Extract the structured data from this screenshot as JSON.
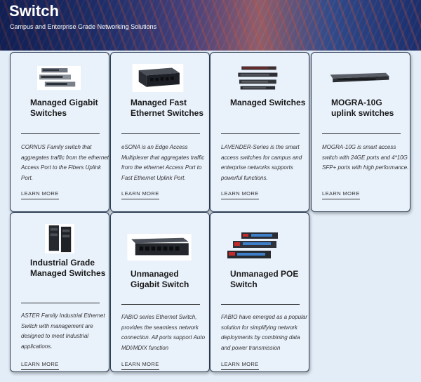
{
  "hero": {
    "title": "Switch",
    "subtitle": "Campus and Enterprise Grade Networking Solutions"
  },
  "cards": [
    {
      "title": "Managed Gigabit Switches",
      "description": "CORNUS Family switch that aggregates traffic from the ethernet Access Port to the Fibers Uplink Port.",
      "link": "LEARN MORE",
      "image_icon": "stacked-gigabit-switches-icon"
    },
    {
      "title": "Managed Fast Ethernet Switches",
      "description": "eSONA is an Edge Access Multiplexer that aggregates traffic from the ethernet Access Port to Fast Ethernet Uplink Port.",
      "link": "LEARN MORE",
      "image_icon": "desktop-switch-icon"
    },
    {
      "title": "Managed Switches",
      "description": "LAVENDER-Series is the smart access switches for campus and enterprise networks supports powerful functions.",
      "link": "LEARN MORE",
      "image_icon": "stacked-rack-switches-icon"
    },
    {
      "title": "MOGRA-10G uplink switches",
      "description": "MOGRA-10G is smart access switch with 24GE ports and 4*10G SFP+ ports with high performance.",
      "link": "LEARN MORE",
      "image_icon": "rack-switch-icon"
    },
    {
      "title": "Industrial Grade Managed Switches",
      "description": "ASTER Family Industrial Ethernet Switch with management are designed to meet Industrial applications.",
      "link": "LEARN MORE",
      "image_icon": "din-rail-switch-icon"
    },
    {
      "title": "Unmanaged Gigabit Switch",
      "description": "FABIO series Ethernet Switch, provides the seamless network connection. All ports support Auto MDI/MDIX function",
      "link": "LEARN MORE",
      "image_icon": "unmanaged-switch-icon"
    },
    {
      "title": "Unmanaged POE Switch",
      "description": "FABIO have emerged as a popular solution for simplifying network deployments by combining data and power transmission",
      "link": "LEARN MORE",
      "image_icon": "poe-switches-icon"
    }
  ]
}
